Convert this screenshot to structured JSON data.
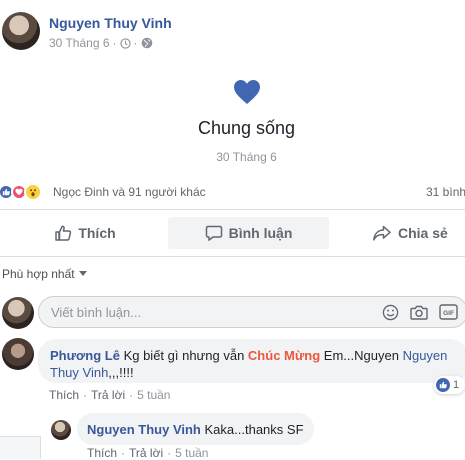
{
  "post": {
    "author": "Nguyen Thuy Vinh",
    "date": "30 Tháng 6",
    "content_title": "Chung sống",
    "content_date": "30 Tháng 6"
  },
  "reactions": {
    "summary": "Ngọc Đinh và 91 người khác",
    "comments_count": "31 bình"
  },
  "actions": {
    "like": "Thích",
    "comment": "Bình luận",
    "share": "Chia sẻ"
  },
  "sort": {
    "label": "Phù hợp nhất"
  },
  "composer": {
    "placeholder": "Viết bình luận..."
  },
  "comments": [
    {
      "author": "Phương Lê",
      "text_part1": "Kg biết gì nhưng vẫn",
      "text_highlight": "Chúc Mừng",
      "text_part2": "Em...Nguyen",
      "text_mention": "Nguyen Thuy Vinh",
      "text_part3": ",,,!!!!",
      "like": "Thích",
      "reply": "Trả lời",
      "time": "5 tuần",
      "reaction_count": "1"
    }
  ],
  "reply": {
    "author": "Nguyen Thuy Vinh",
    "text": "Kaka...thanks SF",
    "like": "Thích",
    "reply": "Trả lời",
    "time": "5 tuần"
  },
  "colors": {
    "brand_blue": "#4267b2",
    "name_blue": "#365899",
    "highlight_orange": "#e9573e",
    "divider": "#dadde1",
    "bubble_bg": "#f2f3f5"
  }
}
